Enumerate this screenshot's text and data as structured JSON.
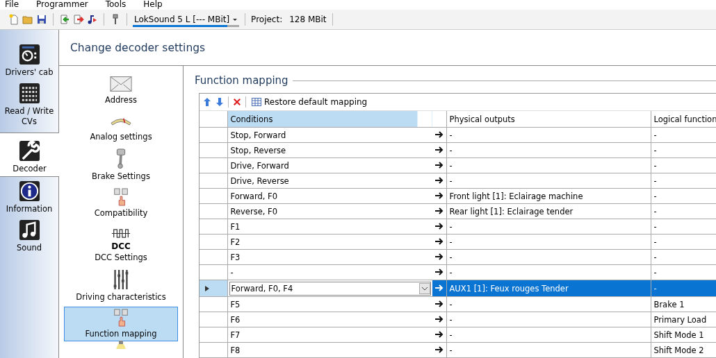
{
  "menu": [
    "File",
    "Programmer",
    "Tools",
    "Help"
  ],
  "toolbar": {
    "decoder": "LokSound 5 L [--- MBit]",
    "level": 0.89,
    "project_label": "Project:",
    "project_value": "128 MBit"
  },
  "nav": [
    {
      "label": "Drivers' cab",
      "selected": false
    },
    {
      "label": "Read / Write CVs",
      "selected": false
    },
    {
      "label": "Decoder",
      "selected": true
    },
    {
      "label": "Information",
      "selected": false
    },
    {
      "label": "Sound",
      "selected": false
    }
  ],
  "header": "Change decoder settings",
  "settings": [
    {
      "label": "Address",
      "selected": false
    },
    {
      "label": "Analog settings",
      "selected": false
    },
    {
      "label": "Brake Settings",
      "selected": false
    },
    {
      "label": "Compatibility",
      "selected": false
    },
    {
      "label": "DCC Settings",
      "icon_text": "DCC",
      "selected": false
    },
    {
      "label": "Driving characteristics",
      "selected": false
    },
    {
      "label": "Function mapping",
      "selected": true
    }
  ],
  "section_title": "Function mapping",
  "grid_toolbar": {
    "restore": "Restore default mapping"
  },
  "columns": [
    "Conditions",
    "Physical outputs",
    "Logical function"
  ],
  "rows": [
    {
      "condition": "Stop, Forward",
      "physical": "-",
      "logical": "-",
      "selected": false
    },
    {
      "condition": "Stop, Reverse",
      "physical": "-",
      "logical": "-",
      "selected": false
    },
    {
      "condition": "Drive, Forward",
      "physical": "-",
      "logical": "-",
      "selected": false
    },
    {
      "condition": "Drive, Reverse",
      "physical": "-",
      "logical": "-",
      "selected": false
    },
    {
      "condition": "Forward, F0",
      "physical": "Front light [1]: Eclairage machine",
      "logical": "-",
      "selected": false
    },
    {
      "condition": "Reverse, F0",
      "physical": "Rear light [1]: Eclairage tender",
      "logical": "-",
      "selected": false
    },
    {
      "condition": "F1",
      "physical": "-",
      "logical": "-",
      "selected": false
    },
    {
      "condition": "F2",
      "physical": "-",
      "logical": "-",
      "selected": false
    },
    {
      "condition": "F3",
      "physical": "-",
      "logical": "-",
      "selected": false
    },
    {
      "condition": "-",
      "physical": "-",
      "logical": "-",
      "selected": false
    },
    {
      "condition": "Forward, F0, F4",
      "physical": "AUX1 [1]: Feux rouges Tender",
      "logical": "-",
      "selected": true
    },
    {
      "condition": "F5",
      "physical": "-",
      "logical": "Brake 1",
      "selected": false
    },
    {
      "condition": "F6",
      "physical": "-",
      "logical": "Primary Load",
      "selected": false
    },
    {
      "condition": "F7",
      "physical": "-",
      "logical": "Shift Mode 1",
      "selected": false
    },
    {
      "condition": "F8",
      "physical": "-",
      "logical": "Shift Mode 2",
      "selected": false
    }
  ]
}
